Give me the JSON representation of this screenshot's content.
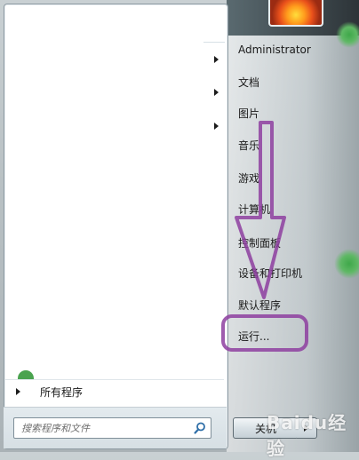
{
  "start_menu": {
    "left_pane": {
      "all_programs_label": "所有程序",
      "search": {
        "placeholder": "搜索程序和文件",
        "icon": "search-icon"
      }
    },
    "right_pane": {
      "user_name": "Administrator",
      "items": [
        {
          "label": "文档"
        },
        {
          "label": "图片"
        },
        {
          "label": "音乐"
        },
        {
          "label": "游戏"
        },
        {
          "label": "计算机"
        },
        {
          "label": "控制面板"
        },
        {
          "label": "设备和打印机"
        },
        {
          "label": "默认程序"
        },
        {
          "label": "运行..."
        }
      ],
      "shutdown_label": "关机"
    }
  },
  "annotation": {
    "color": "#8e3fa0",
    "highlight_item": "运行..."
  },
  "watermark": {
    "text": "Baidu经验"
  }
}
